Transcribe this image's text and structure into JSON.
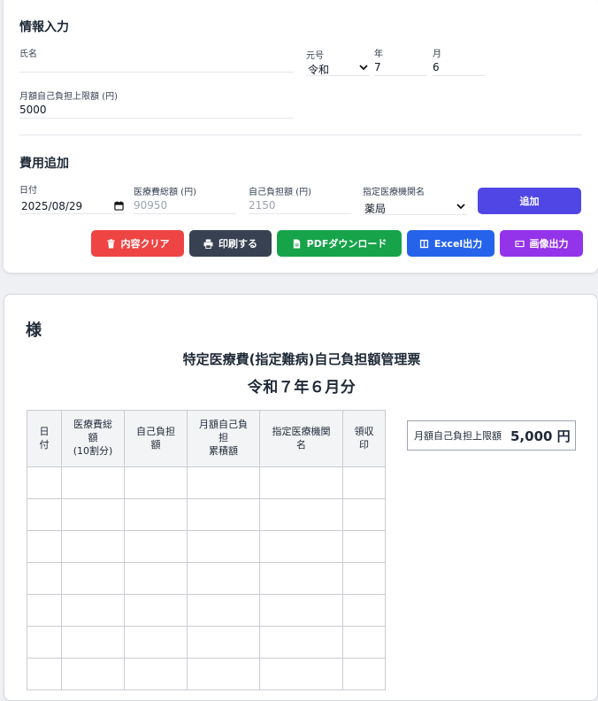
{
  "info": {
    "title": "情報入力",
    "name_label": "氏名",
    "name_value": "",
    "era_label": "元号",
    "era_value": "令和",
    "year_label": "年",
    "year_value": "7",
    "month_label": "月",
    "month_value": "6",
    "limit_label": "月額自己負担上限額 (円)",
    "limit_value": "5000"
  },
  "expense": {
    "title": "費用追加",
    "date_label": "日付",
    "date_value": "2025/08/29",
    "total_label": "医療費総額 (円)",
    "total_placeholder": "90950",
    "self_label": "自己負担額 (円)",
    "self_placeholder": "2150",
    "institution_label": "指定医療機関名",
    "institution_value": "薬局",
    "add_label": "追加"
  },
  "actions": [
    {
      "label": "内容クリア",
      "color": "#ef4444",
      "icon": "trash-icon"
    },
    {
      "label": "印刷する",
      "color": "#374151",
      "icon": "printer-icon"
    },
    {
      "label": "PDFダウンロード",
      "color": "#16a34a",
      "icon": "file-icon"
    },
    {
      "label": "Excel出力",
      "color": "#2563eb",
      "icon": "columns-icon"
    },
    {
      "label": "画像出力",
      "color": "#9333ea",
      "icon": "image-icon"
    }
  ],
  "colors": {
    "add_button": "#4f46e5"
  },
  "sheet": {
    "honorific": "様",
    "title": "特定医療費(指定難病)自己負担額管理票",
    "period": "令和７年６月分",
    "headers": [
      "日付",
      "医療費総額\n(10割分)",
      "自己負担額",
      "月額自己負担\n累積額",
      "指定医療機関名",
      "領収印"
    ],
    "limit_label": "月額自己負担上限額",
    "limit_value": "5,000 円"
  }
}
